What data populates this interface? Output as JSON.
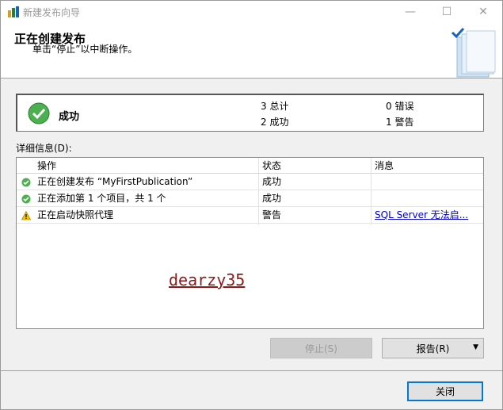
{
  "window": {
    "title": "新建发布向导",
    "min_glyph": "—",
    "max_glyph": "☐",
    "close_glyph": "✕"
  },
  "header": {
    "title": "正在创建发布",
    "subtitle": "单击“停止”以中断操作。"
  },
  "status": {
    "label": "成功",
    "total": "3 总计",
    "success": "2 成功",
    "error": "0 错误",
    "warning": "1 警告"
  },
  "details": {
    "label": "详细信息(D):",
    "columns": [
      "操作",
      "状态",
      "消息"
    ],
    "rows": [
      {
        "icon": "success-icon",
        "action": "正在创建发布 “MyFirstPublication”",
        "status": "成功",
        "message": ""
      },
      {
        "icon": "success-icon",
        "action": "正在添加第 1 个项目，共 1 个",
        "status": "成功",
        "message": ""
      },
      {
        "icon": "warning-icon",
        "action": "正在启动快照代理",
        "status": "警告",
        "message": "SQL Server 无法启..."
      }
    ]
  },
  "watermark": "dearzy35",
  "buttons": {
    "stop": "停止(S)",
    "report": "报告(R)",
    "close": "关闭"
  },
  "colors": {
    "success": "#4caf50",
    "warning": "#f5c400",
    "link": "#0000cc",
    "focus": "#0078d7"
  }
}
